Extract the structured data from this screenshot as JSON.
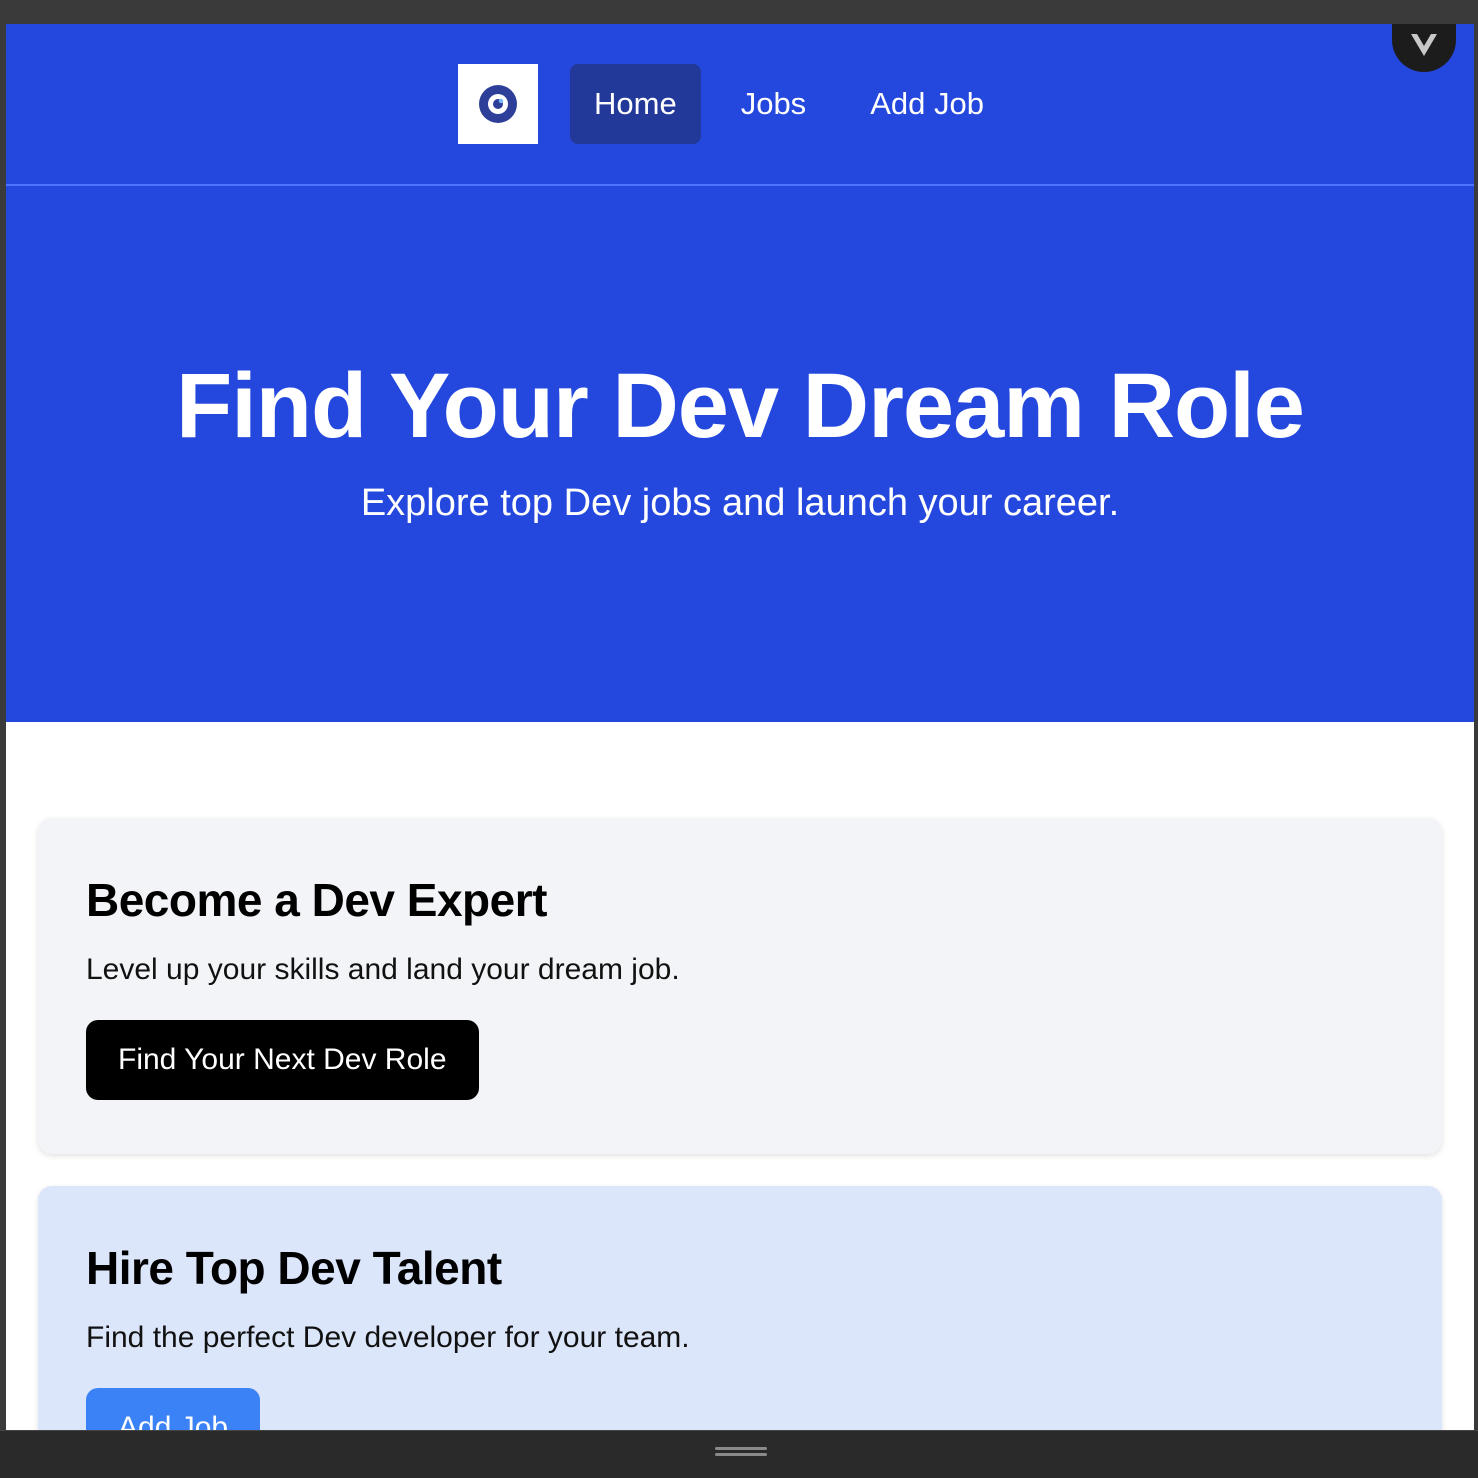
{
  "nav": {
    "logo_icon": "target-logo-icon",
    "links": [
      {
        "label": "Home",
        "active": true
      },
      {
        "label": "Jobs",
        "active": false
      },
      {
        "label": "Add Job",
        "active": false
      }
    ]
  },
  "hero": {
    "title": "Find Your Dev Dream Role",
    "subtitle": "Explore top Dev jobs and launch your career."
  },
  "cards": [
    {
      "title": "Become a Dev Expert",
      "text": "Level up your skills and land your dream job.",
      "button": "Find Your Next Dev Role"
    },
    {
      "title": "Hire Top Dev Talent",
      "text": "Find the perfect Dev developer for your team.",
      "button": "Add Job"
    }
  ],
  "colors": {
    "primary": "#2448dd",
    "nav_active": "#23399a",
    "card_light": "#f2f4f7",
    "card_blue": "#dce6fa",
    "button_blue": "#3b82f6"
  }
}
